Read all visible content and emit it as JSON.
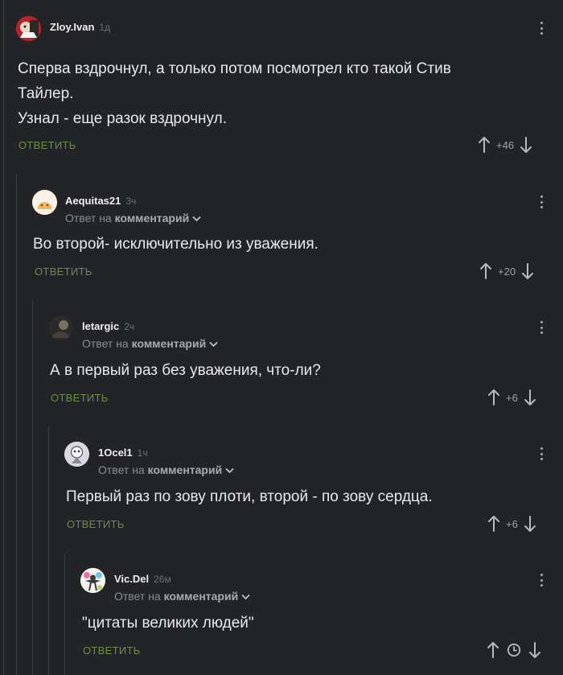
{
  "comments": [
    {
      "username": "Zloy.Ivan",
      "time": "1д",
      "text_lines": [
        "Сперва вздрочнул, а только потом посмотрел кто такой Стив",
        "Тайлер.",
        "Узнал - еще разок вздрочнул."
      ],
      "reply_label": "ОТВЕТИТЬ",
      "votes": "+46"
    },
    {
      "username": "Aequitas21",
      "time": "3ч",
      "reply_prefix": "Ответ на",
      "reply_target": "комментарий",
      "text_lines": [
        "Во второй- исключительно из уважения."
      ],
      "reply_label": "ОТВЕТИТЬ",
      "votes": "+20"
    },
    {
      "username": "letargic",
      "time": "2ч",
      "reply_prefix": "Ответ на",
      "reply_target": "комментарий",
      "text_lines": [
        "А в первый раз без уважения, что-ли?"
      ],
      "reply_label": "ОТВЕТИТЬ",
      "votes": "+6"
    },
    {
      "username": "1Ocel1",
      "time": "1ч",
      "reply_prefix": "Ответ на",
      "reply_target": "комментарий",
      "text_lines": [
        "Первый раз по зову плоти, второй - по зову сердца."
      ],
      "reply_label": "ОТВЕТИТЬ",
      "votes": "+6"
    },
    {
      "username": "Vic.Del",
      "time": "26м",
      "reply_prefix": "Ответ на",
      "reply_target": "комментарий",
      "text_lines": [
        "\"цитаты великих людей\""
      ],
      "reply_label": "ОТВЕТИТЬ",
      "votes": ""
    }
  ],
  "icons": {
    "up": "arrow-up-icon",
    "down": "arrow-down-icon",
    "more": "more-vertical-icon",
    "clock": "clock-icon",
    "chevron": "chevron-down-icon"
  },
  "colors": {
    "background": "#222427",
    "reply_button": "#6d8f45",
    "thread_line": "#3a3d41"
  }
}
